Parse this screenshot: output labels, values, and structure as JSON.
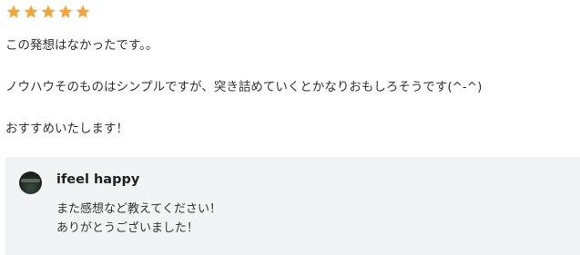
{
  "rating": {
    "value": 5,
    "max": 5,
    "star_color": "#f4a639"
  },
  "review": {
    "lines": [
      "この発想はなかったです。。",
      "ノウハウそのものはシンプルですが、突き詰めていくとかなりおもしろそうです(^-^)",
      "おすすめいたします！"
    ]
  },
  "reply": {
    "author": "ifeel happy",
    "avatar_icon": "avatar-photo",
    "background_color": "#f2f3f4",
    "lines": [
      "また感想など教えてください！",
      "ありがとうございました！"
    ]
  }
}
